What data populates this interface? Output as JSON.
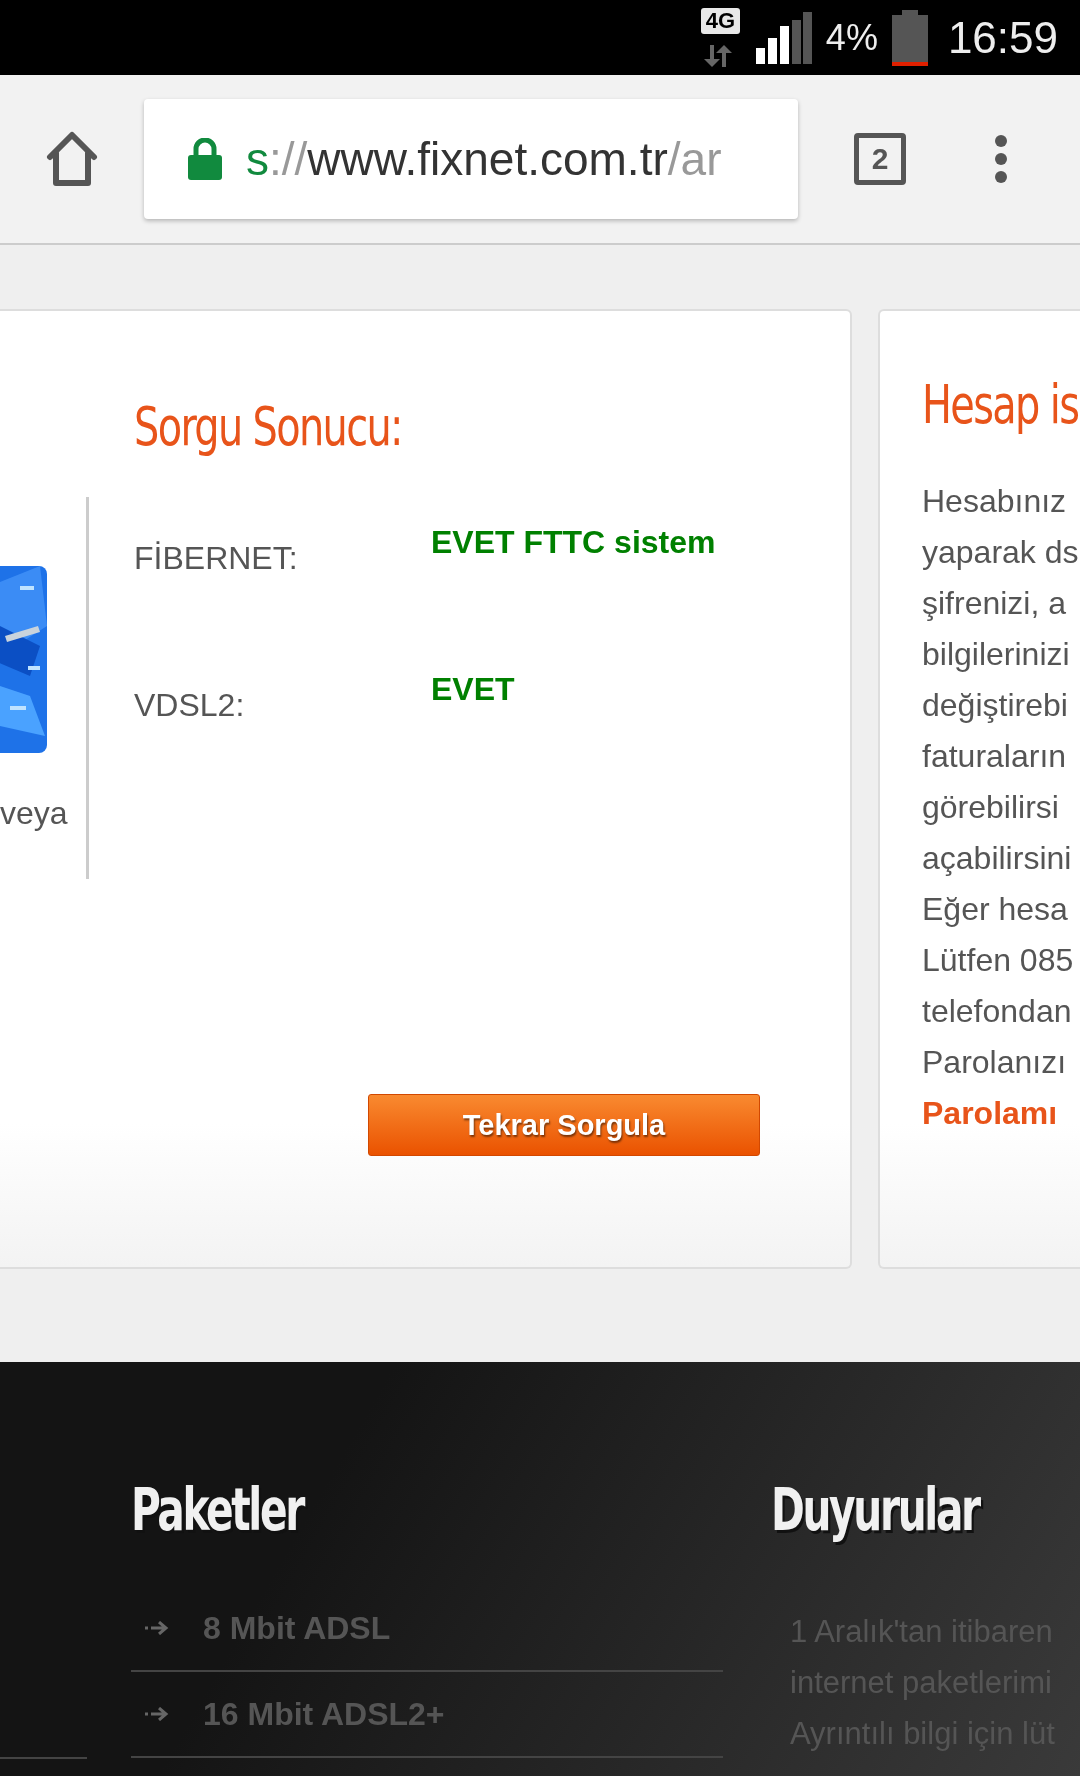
{
  "status_bar": {
    "network": "4G",
    "battery": "4%",
    "time": "16:59"
  },
  "browser": {
    "url_scheme": "s",
    "url_separator": "://",
    "url_host": "www.fixnet.com.tr",
    "url_path": "/ar",
    "tab_count": "2"
  },
  "result_card": {
    "side_text": "veya",
    "title": "Sorgu Sonucu:",
    "rows": [
      {
        "label": "FİBERNET:",
        "value": "EVET FTTC sistem"
      },
      {
        "label": "VDSL2:",
        "value": "EVET"
      }
    ],
    "button": "Tekrar Sorgula"
  },
  "account_card": {
    "title": "Hesap is",
    "lines": [
      "Hesabınız",
      "yaparak ds",
      "şifrenizi, a",
      "bilgilerinizi",
      "değiştirebi",
      "faturaların",
      "görebilirsi",
      "açabilirsini",
      "Eğer hesa",
      "Lütfen 085",
      "telefondan",
      "Parolanızı"
    ],
    "link": "Parolamı"
  },
  "footer": {
    "packages": {
      "title": "Paketler",
      "items": [
        "8 Mbit ADSL",
        "16 Mbit ADSL2+"
      ]
    },
    "announcements": {
      "title": "Duyurular",
      "lines": [
        "1 Aralık'tan itibaren",
        "internet paketlerimi",
        "Ayrıntılı bilgi için lüt"
      ]
    }
  }
}
